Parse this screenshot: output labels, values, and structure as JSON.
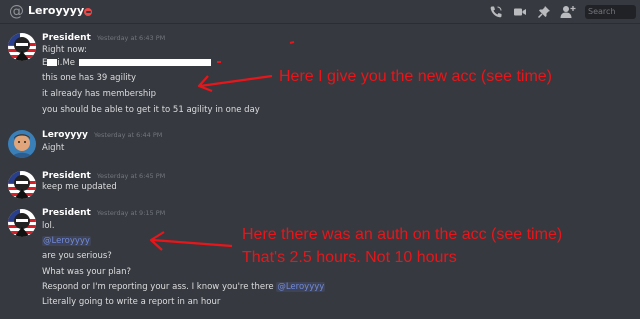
{
  "header": {
    "title": "Leroyyyy",
    "search_placeholder": "Search",
    "icons": [
      "at-icon",
      "call-icon",
      "video-icon",
      "pin-icon",
      "add-friend-icon"
    ]
  },
  "messages": [
    {
      "author": "President",
      "timestamp": "Yesterday at 6:43 PM",
      "lines": [
        "Right now:",
        "E",
        "i.Me",
        "this one has 39 agility",
        "it already has membership",
        "you should be able to get it to 51 agility in one day"
      ]
    },
    {
      "author": "Leroyyyy",
      "timestamp": "Yesterday at 6:44 PM",
      "lines": [
        "Aight"
      ]
    },
    {
      "author": "President",
      "timestamp": "Yesterday at 6:45 PM",
      "lines": [
        "keep me updated"
      ]
    },
    {
      "author": "President",
      "timestamp": "Yesterday at 9:15 PM",
      "lines": [
        "lol.",
        "@Leroyyyy",
        "are you serious?",
        "What was your plan?",
        "Respond or I'm reporting your ass. I know you're there ",
        "@Leroyyyy",
        "Literally going to write a report in an hour"
      ]
    }
  ],
  "annotations": {
    "first": "Here I give you the new acc (see time)",
    "second_line1": "Here there was an auth on the acc (see time)",
    "second_line2": "That's 2.5 hours. Not 10 hours"
  },
  "colors": {
    "background": "#36393f",
    "annotation": "#e8161a",
    "mention": "#7289da",
    "dnd": "#f04747"
  }
}
